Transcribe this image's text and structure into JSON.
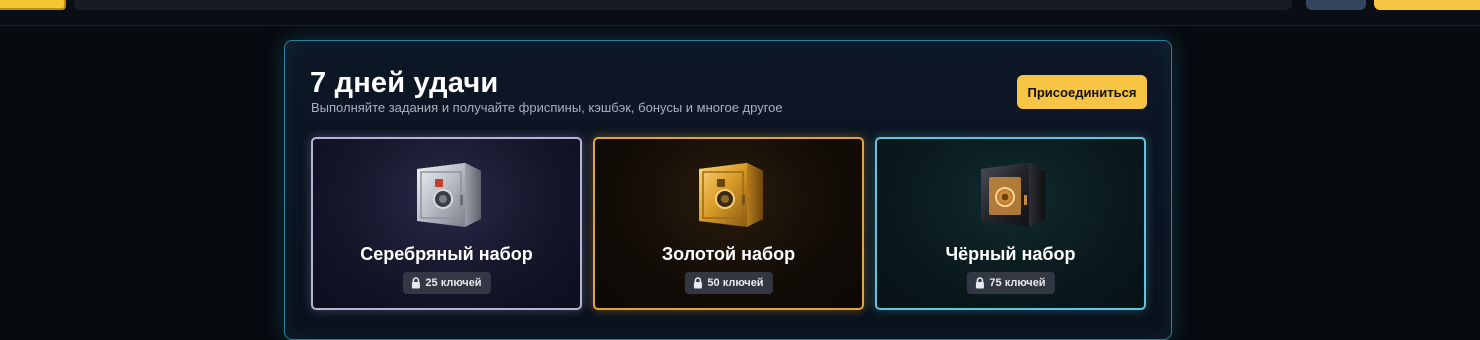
{
  "header": {
    "icons": [
      "logo",
      "search-bar",
      "secondary-button",
      "primary-button"
    ]
  },
  "promo": {
    "title": "7 дней удачи",
    "subtitle": "Выполняйте задания и получайте фриспины, кэшбэк, бонусы и многое другое",
    "join_label": "Присоединиться",
    "accent_color": "#f7c443",
    "border_color": "#2e7f96"
  },
  "sets": [
    {
      "name": "Серебряный набор",
      "keys": "25 ключей",
      "icon": "silver-safe-icon",
      "color": "#b6b3d6"
    },
    {
      "name": "Золотой набор",
      "keys": "50 ключей",
      "icon": "gold-safe-icon",
      "color": "#e2a52f"
    },
    {
      "name": "Чёрный набор",
      "keys": "75 ключей",
      "icon": "black-safe-icon",
      "color": "#5fc6db"
    }
  ]
}
